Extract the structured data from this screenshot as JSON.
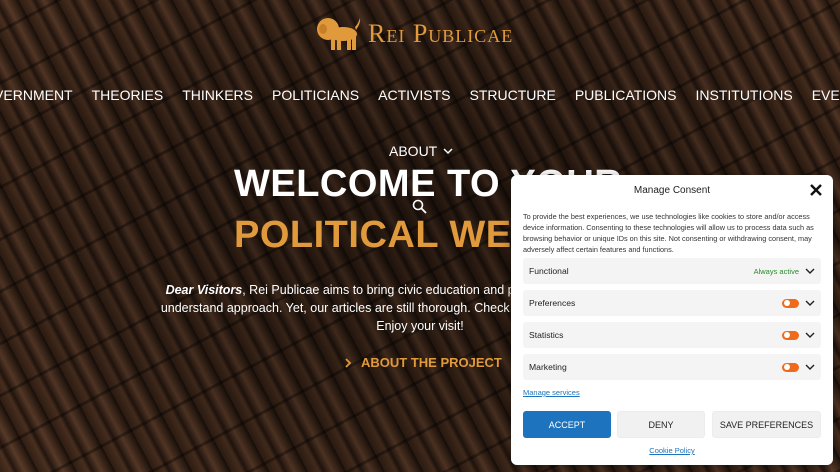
{
  "brand": {
    "name": "Rei Publicae",
    "accent": "#e09a3c"
  },
  "nav": {
    "items": [
      {
        "label": "GOVERNMENT"
      },
      {
        "label": "THEORIES"
      },
      {
        "label": "THINKERS"
      },
      {
        "label": "POLITICIANS"
      },
      {
        "label": "ACTIVISTS"
      },
      {
        "label": "STRUCTURE"
      },
      {
        "label": "PUBLICATIONS"
      },
      {
        "label": "INSTITUTIONS"
      },
      {
        "label": "EVENTS"
      }
    ],
    "about": "ABOUT"
  },
  "hero": {
    "title_line1": "WELCOME TO YOUR",
    "title_line2": "POLITICAL WEEKLY",
    "intro_lead": "Dear Visitors",
    "intro_line1_rest": ", Rei Publicae aims to bring civic education and political science in an easy-to-",
    "intro_line2": "understand approach. Yet, our articles are still thorough. Check the sections above to explore.",
    "intro_line3": "Enjoy your visit!",
    "cta": "ABOUT THE PROJECT"
  },
  "consent": {
    "title": "Manage Consent",
    "description": "To provide the best experiences, we use technologies like cookies to store and/or access device information. Consenting to these technologies will allow us to process data such as browsing behavior or unique IDs on this site. Not consenting or withdrawing consent, may adversely affect certain features and functions.",
    "categories": [
      {
        "label": "Functional",
        "status": "Always active"
      },
      {
        "label": "Preferences"
      },
      {
        "label": "Statistics"
      },
      {
        "label": "Marketing"
      }
    ],
    "manage_link": "Manage services",
    "accept": "ACCEPT",
    "deny": "DENY",
    "save": "SAVE PREFERENCES",
    "policy": "Cookie Policy",
    "toggle_color": "#ef6a1a",
    "button_color": "#1e73be"
  }
}
